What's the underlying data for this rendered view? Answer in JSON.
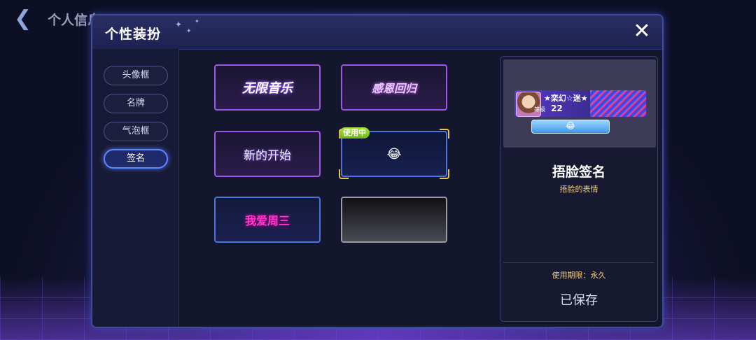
{
  "background": {
    "title": "个人信息"
  },
  "dialog": {
    "title": "个性装扮",
    "close_icon": "close-icon"
  },
  "sidebar": {
    "tabs": [
      {
        "label": "头像框",
        "active": false
      },
      {
        "label": "名牌",
        "active": false
      },
      {
        "label": "气泡框",
        "active": false
      },
      {
        "label": "签名",
        "active": true
      }
    ]
  },
  "grid": {
    "items": [
      {
        "label": "无限音乐",
        "style": "purple"
      },
      {
        "label": "感恩回归",
        "style": "purple"
      },
      {
        "label": "新的开始",
        "style": "purple"
      },
      {
        "label": "😂",
        "style": "selected",
        "badge": "使用中"
      },
      {
        "label": "我爱周三",
        "style": "blue"
      },
      {
        "label": "",
        "style": "gray"
      }
    ]
  },
  "detail": {
    "preview": {
      "player_name": "★栾幻☆迷★",
      "level_label": "等级",
      "level": "22",
      "signature": "😂"
    },
    "title": "捂脸签名",
    "description": "捂脸的表情",
    "expire": "使用期限：永久",
    "status": "已保存"
  },
  "colors": {
    "accent": "#5e86ff",
    "gold": "#f0d080",
    "badge_green": "#8bcf2a"
  }
}
